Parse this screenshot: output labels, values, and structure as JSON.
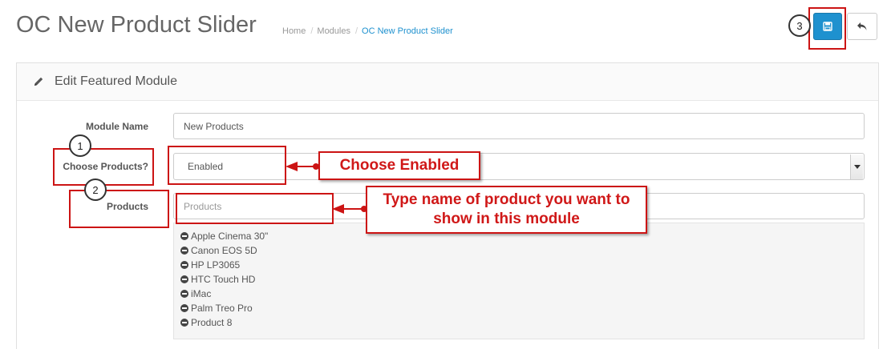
{
  "header": {
    "title": "OC New Product Slider",
    "breadcrumb": [
      "Home",
      "Modules",
      "OC New Product Slider"
    ]
  },
  "toolbar": {
    "save_icon": "save-icon",
    "back_icon": "reply-icon"
  },
  "panel": {
    "title": "Edit Featured Module",
    "icon": "pencil-icon"
  },
  "form": {
    "module_name_label": "Module Name",
    "module_name_value": "New Products",
    "choose_products_label": "Choose Products?",
    "choose_products_value": "Enabled",
    "products_label": "Products",
    "products_placeholder": "Products",
    "products": [
      "Apple Cinema 30\"",
      "Canon EOS 5D",
      "HP LP3065",
      "HTC Touch HD",
      "iMac",
      "Palm Treo Pro",
      "Product 8"
    ]
  },
  "annotations": {
    "step1": "1",
    "step2": "2",
    "step3": "3",
    "callout_enabled": "Choose Enabled",
    "callout_products": "Type name of product you want to show in this module",
    "color": "#cc1414"
  }
}
